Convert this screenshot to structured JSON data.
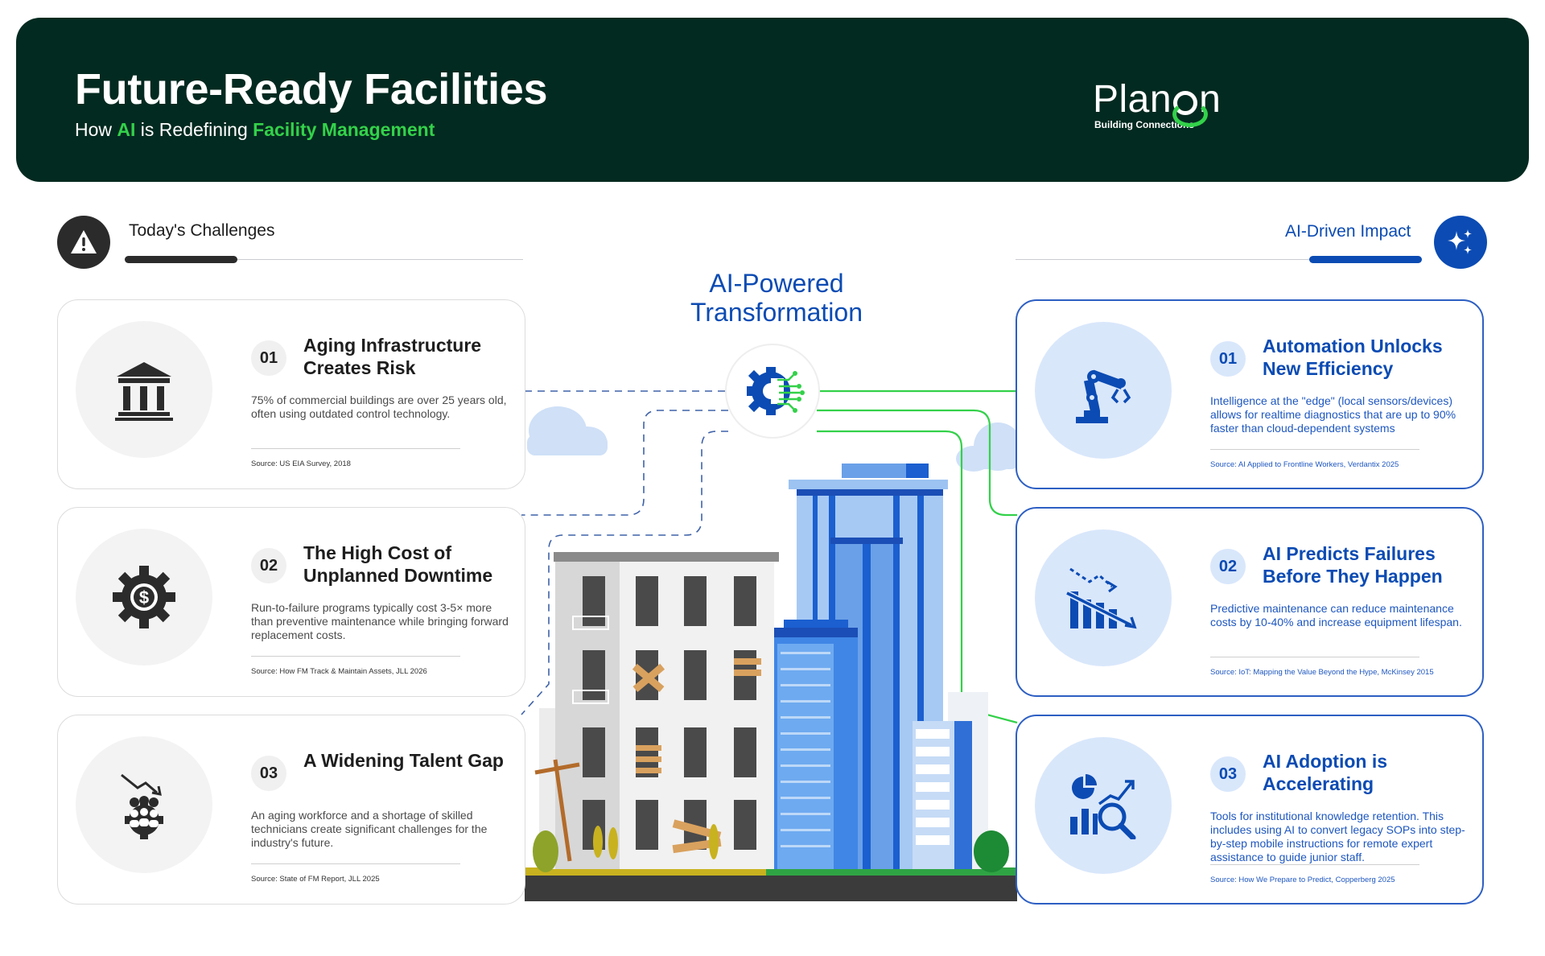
{
  "header": {
    "title": "Future-Ready Facilities",
    "subtitle_pre": "How ",
    "subtitle_ai": "AI",
    "subtitle_mid": " is Redefining ",
    "subtitle_fm": "Facility Management",
    "logo_left": "Plan",
    "logo_right": "n",
    "logo_tagline": "Building Connections"
  },
  "colors": {
    "header_bg": "#032a20",
    "accent_green": "#33d14a",
    "accent_blue": "#0b4bb3",
    "challenge_dark": "#2b2b2b"
  },
  "challenges": {
    "label": "Today's Challenges",
    "icon": "warning-icon",
    "items": [
      {
        "num": "01",
        "title": "Aging Infrastructure Creates Risk",
        "desc": "75% of commercial buildings are over 25 years old, often using outdated control technology.",
        "source": "Source: US EIA Survey, 2018",
        "icon": "bank-building-icon"
      },
      {
        "num": "02",
        "title": "The High Cost of Unplanned Downtime",
        "desc": "Run-to-failure programs typically cost 3-5× more than preventive maintenance while bringing forward replacement costs.",
        "source": "Source: How FM Track & Maintain Assets, JLL 2026",
        "icon": "gear-dollar-icon"
      },
      {
        "num": "03",
        "title": "A Widening Talent Gap",
        "desc": "An aging workforce and a shortage of skilled technicians create significant challenges for the industry's future.",
        "source": "Source: State of FM Report, JLL 2025",
        "icon": "workforce-decline-icon"
      }
    ]
  },
  "center": {
    "title_line1": "AI-Powered",
    "title_line2": "Transformation",
    "icon": "ai-gear-circuit-icon"
  },
  "impact": {
    "label": "AI-Driven Impact",
    "icon": "sparkle-icon",
    "items": [
      {
        "num": "01",
        "title": "Automation Unlocks New Efficiency",
        "desc": "Intelligence at the \"edge\" (local sensors/devices) allows for realtime diagnostics that are up to 90% faster than cloud-dependent systems",
        "source": "Source: AI Applied to Frontline Workers, Verdantix 2025",
        "icon": "robot-arm-icon"
      },
      {
        "num": "02",
        "title": "AI Predicts Failures Before They Happen",
        "desc": "Predictive maintenance can reduce maintenance costs by 10-40% and increase equipment lifespan.",
        "source": "Source: IoT: Mapping the Value Beyond the Hype, McKinsey 2015",
        "icon": "bar-chart-decline-icon"
      },
      {
        "num": "03",
        "title": "AI Adoption is Accelerating",
        "desc": "Tools for institutional knowledge retention. This includes using AI to convert legacy SOPs into step-by-step mobile instructions for remote expert assistance to guide junior staff.",
        "source": "Source: How We Prepare to Predict, Copperberg 2025",
        "icon": "analytics-search-icon"
      }
    ]
  }
}
